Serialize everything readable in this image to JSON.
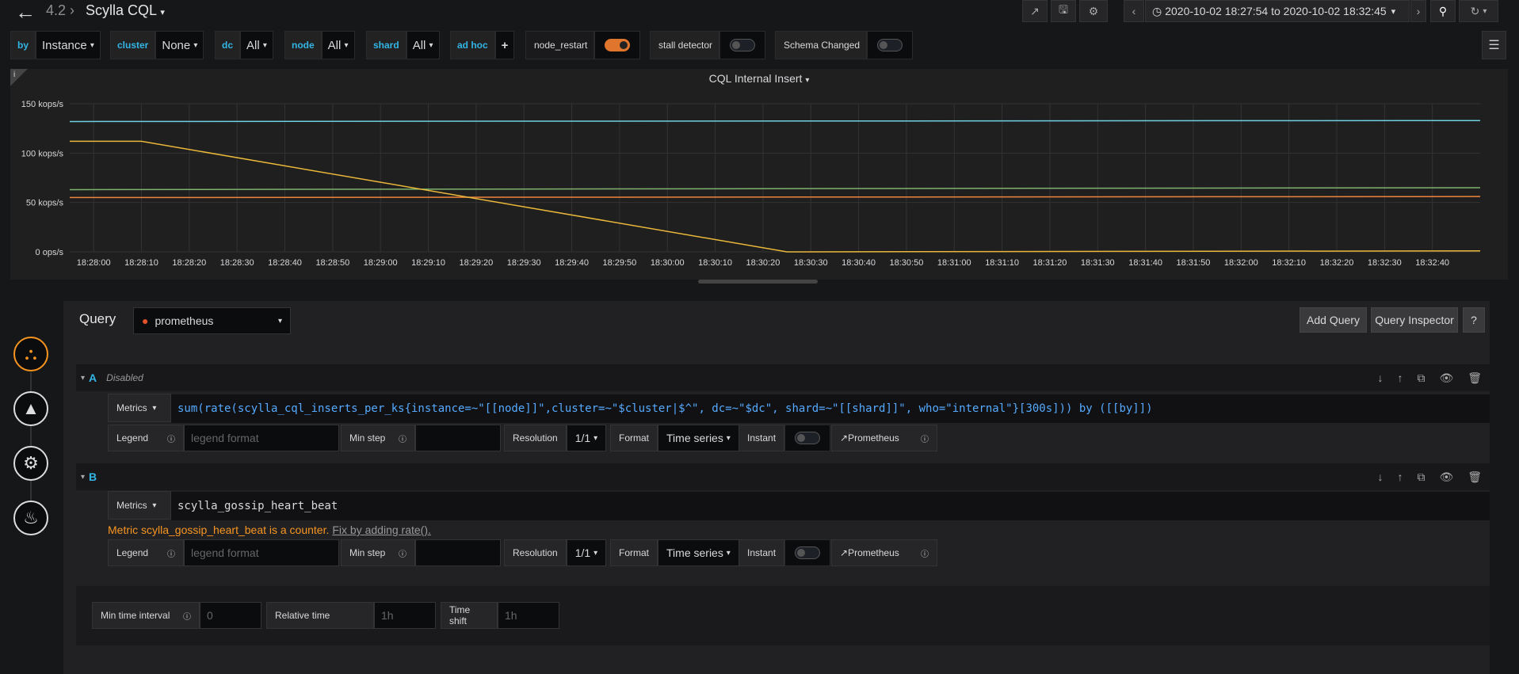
{
  "header": {
    "version": "4.2",
    "dashboard_title": "Scylla CQL",
    "time_range": "2020-10-02 18:27:54 to 2020-10-02 18:32:45"
  },
  "variables": [
    {
      "label": "by",
      "value": "Instance"
    },
    {
      "label": "cluster",
      "value": "None"
    },
    {
      "label": "dc",
      "value": "All"
    },
    {
      "label": "node",
      "value": "All"
    },
    {
      "label": "shard",
      "value": "All"
    },
    {
      "label": "ad hoc",
      "value": "+"
    }
  ],
  "toggles": [
    {
      "label": "node_restart",
      "on": true
    },
    {
      "label": "stall detector",
      "on": false
    },
    {
      "label": "Schema Changed",
      "on": false
    }
  ],
  "panel": {
    "title": "CQL Internal Insert"
  },
  "chart_data": {
    "type": "line",
    "title": "CQL Internal Insert",
    "y_ticks": [
      "0 ops/s",
      "50 kops/s",
      "100 kops/s",
      "150 kops/s"
    ],
    "ylim": [
      0,
      150
    ],
    "x_ticks": [
      "18:28:00",
      "18:28:10",
      "18:28:20",
      "18:28:30",
      "18:28:40",
      "18:28:50",
      "18:29:00",
      "18:29:10",
      "18:29:20",
      "18:29:30",
      "18:29:40",
      "18:29:50",
      "18:30:00",
      "18:30:10",
      "18:30:20",
      "18:30:30",
      "18:30:40",
      "18:30:50",
      "18:31:00",
      "18:31:10",
      "18:31:20",
      "18:31:30",
      "18:31:40",
      "18:31:50",
      "18:32:00",
      "18:32:10",
      "18:32:20",
      "18:32:30",
      "18:32:40"
    ],
    "x_seconds": [
      -5,
      290
    ],
    "series": [
      {
        "color": "#6ed0e0",
        "points": [
          [
            -5,
            132
          ],
          [
            290,
            133
          ]
        ]
      },
      {
        "color": "#7eb26d",
        "points": [
          [
            -5,
            63
          ],
          [
            290,
            65
          ]
        ]
      },
      {
        "color": "#ef843c",
        "points": [
          [
            -5,
            55
          ],
          [
            290,
            56
          ]
        ]
      },
      {
        "color": "#eab839",
        "points": [
          [
            -5,
            112
          ],
          [
            10,
            112
          ],
          [
            145,
            0
          ],
          [
            290,
            1
          ]
        ]
      }
    ],
    "grid": true
  },
  "query_editor": {
    "heading": "Query",
    "datasource": "prometheus",
    "add_query": "Add Query",
    "query_inspector": "Query Inspector",
    "help": "?",
    "queries": [
      {
        "letter": "A",
        "status": "Disabled",
        "metrics_label": "Metrics",
        "expr": "sum(rate(scylla_cql_inserts_per_ks{instance=~\"[[node]]\",cluster=~\"$cluster|$^\", dc=~\"$dc\", shard=~\"[[shard]]\", who=\"internal\"}[300s])) by ([[by]])",
        "legend_label": "Legend",
        "legend_placeholder": "legend format",
        "minstep_label": "Min step",
        "resolution_label": "Resolution",
        "resolution_value": "1/1",
        "format_label": "Format",
        "format_value": "Time series",
        "instant_label": "Instant",
        "prometheus_link": "Prometheus"
      },
      {
        "letter": "B",
        "status": "",
        "metrics_label": "Metrics",
        "expr": "scylla_gossip_heart_beat",
        "warning": "Metric scylla_gossip_heart_beat is a counter.",
        "fix_link": "Fix by adding rate().",
        "legend_label": "Legend",
        "legend_placeholder": "legend format",
        "minstep_label": "Min step",
        "resolution_label": "Resolution",
        "resolution_value": "1/1",
        "format_label": "Format",
        "format_value": "Time series",
        "instant_label": "Instant",
        "prometheus_link": "Prometheus"
      }
    ],
    "options": {
      "min_interval_label": "Min time interval",
      "min_interval_placeholder": "0",
      "relative_time_label": "Relative time",
      "relative_time_placeholder": "1h",
      "time_shift_label": "Time shift",
      "time_shift_placeholder": "1h"
    }
  }
}
